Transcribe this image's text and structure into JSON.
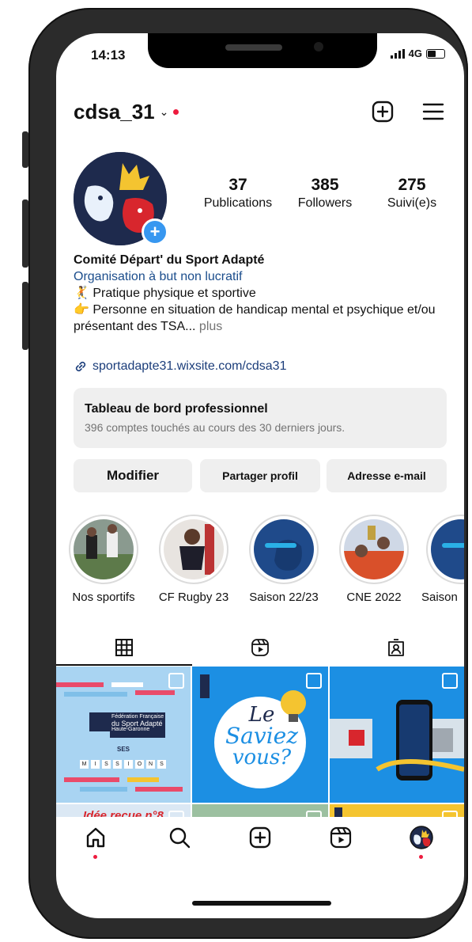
{
  "status": {
    "time": "14:13",
    "network": "4G"
  },
  "header": {
    "username": "cdsa_31",
    "chevron": "⌄"
  },
  "stats": [
    {
      "value": "37",
      "label": "Publications"
    },
    {
      "value": "385",
      "label": "Followers"
    },
    {
      "value": "275",
      "label": "Suivi(e)s"
    }
  ],
  "bio": {
    "name": "Comité Départ' du Sport Adapté",
    "category": "Organisation à but non lucratif",
    "line1": "Pratique physique et sportive",
    "line2": "Personne en situation de handicap mental et psychique et/ou présentant des TSA...",
    "more": "plus",
    "link": "sportadapte31.wixsite.com/cdsa31"
  },
  "dashboard": {
    "title": "Tableau de bord professionnel",
    "subtitle": "396 comptes touchés au cours des 30 derniers jours."
  },
  "buttons": {
    "edit": "Modifier",
    "share": "Partager profil",
    "email": "Adresse e-mail"
  },
  "highlights": [
    {
      "label": "Nos sportifs"
    },
    {
      "label": "CF Rugby 23"
    },
    {
      "label": "Saison 22/23"
    },
    {
      "label": "CNE 2022"
    },
    {
      "label": "Saison"
    }
  ],
  "posts": {
    "p1": {
      "org_line1": "Fédération Française",
      "org_line2": "du Sport Adapté",
      "org_line3": "Haute-Garonne",
      "ses": "SES",
      "letters": [
        "M",
        "I",
        "S",
        "S",
        "I",
        "O",
        "N",
        "S"
      ]
    },
    "p2": {
      "line1": "Le",
      "line2": "Saviez",
      "line3": "vous?"
    },
    "p4": {
      "text": "Idée reçue n°8"
    }
  },
  "colors": {
    "accent": "#3797f0",
    "notify": "#ed1b3e",
    "link": "#1b3d7a",
    "grey_button": "#efefef"
  },
  "icons": {
    "tabs": [
      "grid-icon",
      "reels-icon",
      "tagged-icon"
    ],
    "nav": [
      "home-icon",
      "search-icon",
      "create-icon",
      "reels-icon",
      "profile-avatar"
    ]
  }
}
